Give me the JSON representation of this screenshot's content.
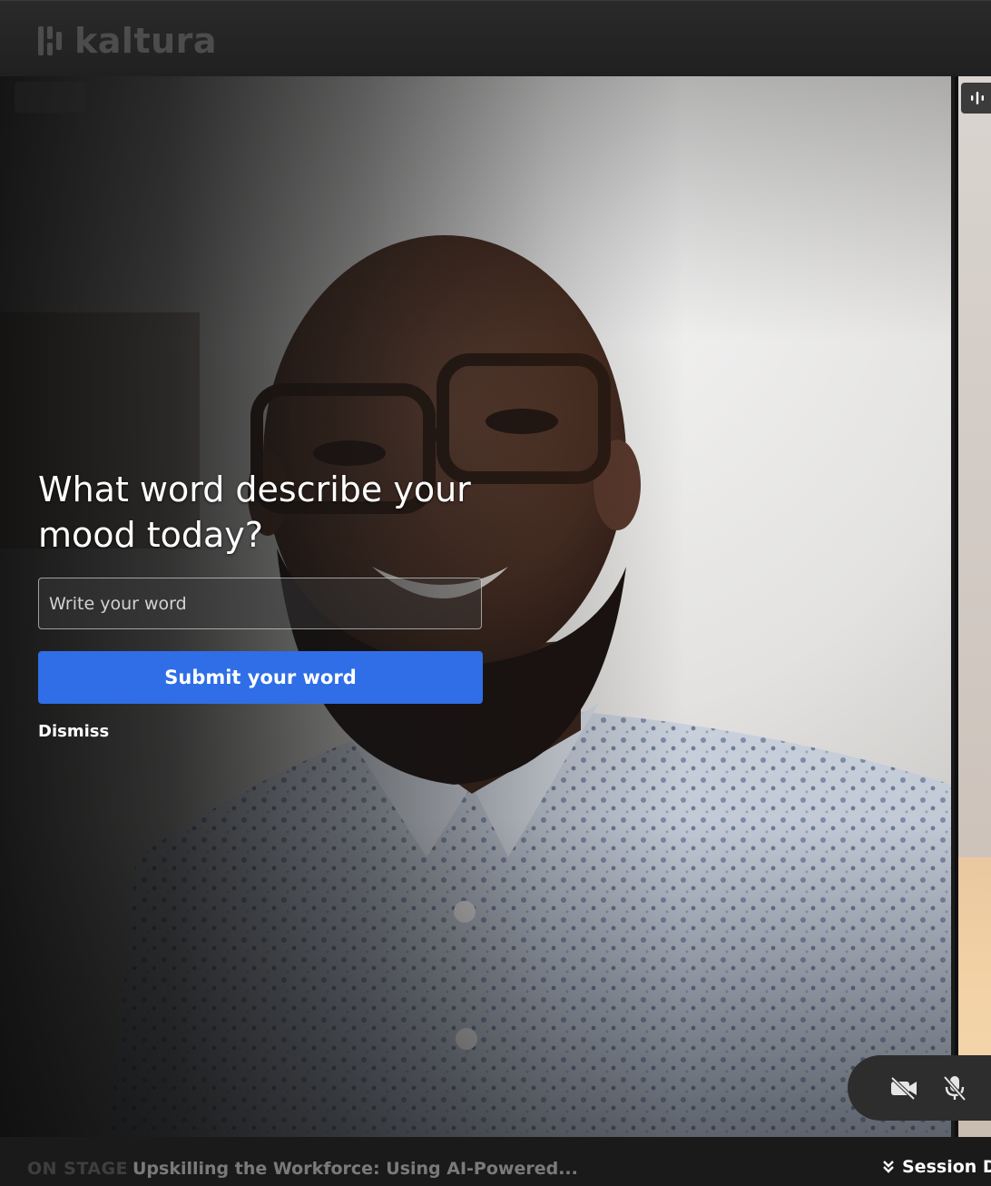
{
  "header": {
    "logo_text": "kaltura"
  },
  "stage": {
    "live_badge": ""
  },
  "poll": {
    "question": "What word describe your mood today?",
    "input_placeholder": "Write your word",
    "input_value": "",
    "submit_label": "Submit your word",
    "dismiss_label": "Dismiss"
  },
  "media_controls": {
    "camera_icon": "video-off-icon",
    "mic_icon": "mic-off-icon"
  },
  "footer": {
    "on_stage_label": "ON STAGE",
    "session_title": "Upskilling the Workforce: Using AI-Powered...",
    "session_details_label": "Session De",
    "session_details_icon": "chevron-double-down-icon"
  },
  "colors": {
    "accent": "#2f6ee7",
    "header_bg": "#252525",
    "footer_bg": "#1a1a1a",
    "controls_bg": "#2d2d2d"
  }
}
